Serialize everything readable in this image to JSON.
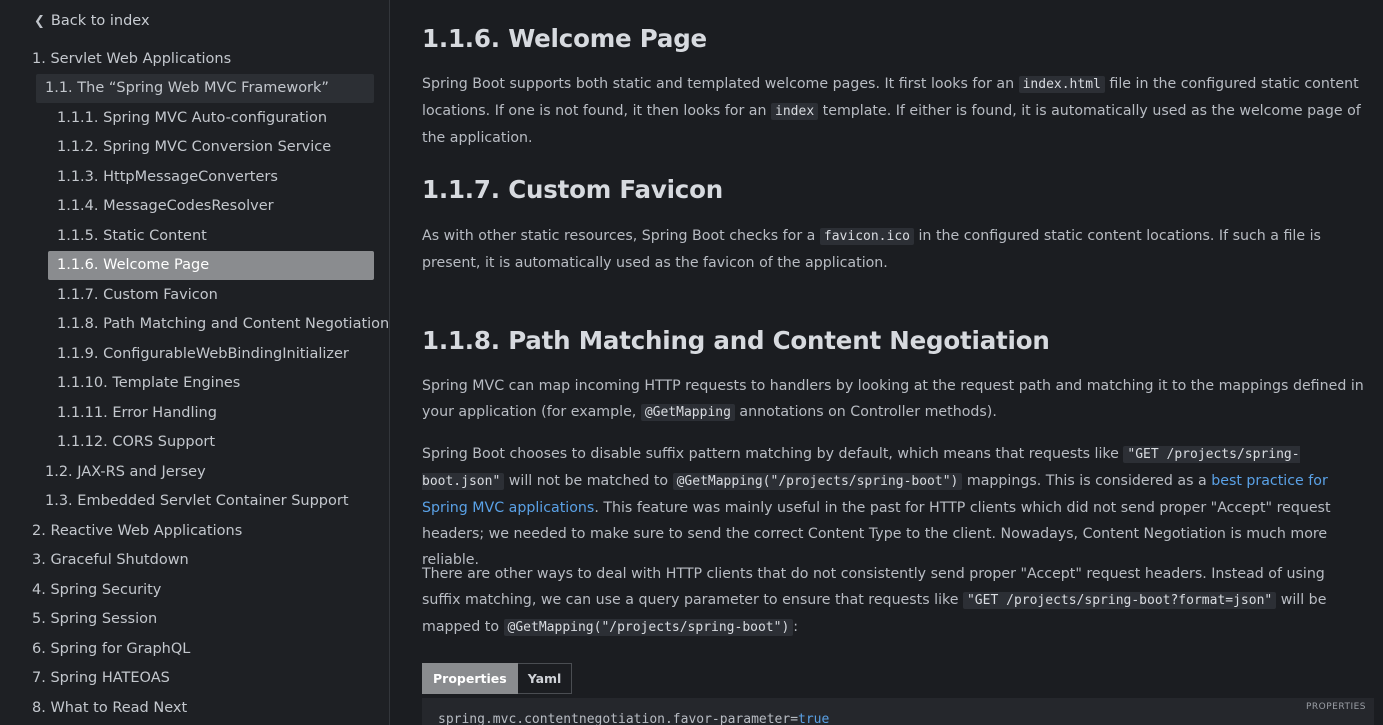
{
  "sidebar": {
    "back_label": "Back to index",
    "items": [
      {
        "label": "1. Servlet Web Applications",
        "level": 0
      },
      {
        "label": "1.1. The “Spring Web MVC Framework”",
        "level": 1
      },
      {
        "label": "1.1.1. Spring MVC Auto-configuration",
        "level": 2
      },
      {
        "label": "1.1.2. Spring MVC Conversion Service",
        "level": 2
      },
      {
        "label": "1.1.3. HttpMessageConverters",
        "level": 2
      },
      {
        "label": "1.1.4. MessageCodesResolver",
        "level": 2
      },
      {
        "label": "1.1.5. Static Content",
        "level": 2
      },
      {
        "label": "1.1.6. Welcome Page",
        "level": 2
      },
      {
        "label": "1.1.7. Custom Favicon",
        "level": 2
      },
      {
        "label": "1.1.8. Path Matching and Content Negotiation",
        "level": 2
      },
      {
        "label": "1.1.9. ConfigurableWebBindingInitializer",
        "level": 2
      },
      {
        "label": "1.1.10. Template Engines",
        "level": 2
      },
      {
        "label": "1.1.11. Error Handling",
        "level": 2
      },
      {
        "label": "1.1.12. CORS Support",
        "level": 2
      },
      {
        "label": "1.2. JAX-RS and Jersey",
        "level": 1
      },
      {
        "label": "1.3. Embedded Servlet Container Support",
        "level": 1
      },
      {
        "label": "2. Reactive Web Applications",
        "level": 0
      },
      {
        "label": "3. Graceful Shutdown",
        "level": 0
      },
      {
        "label": "4. Spring Security",
        "level": 0
      },
      {
        "label": "5. Spring Session",
        "level": 0
      },
      {
        "label": "6. Spring for GraphQL",
        "level": 0
      },
      {
        "label": "7. Spring HATEOAS",
        "level": 0
      },
      {
        "label": "8. What to Read Next",
        "level": 0
      }
    ],
    "active_label": "1.1.6. Welcome Page"
  },
  "sections": {
    "welcome": {
      "title": "1.1.6. Welcome Page",
      "p1_a": "Spring Boot supports both static and templated welcome pages. It first looks for an ",
      "p1_code1": "index.html",
      "p1_b": " file in the configured static content locations. If one is not found, it then looks for an ",
      "p1_code2": "index",
      "p1_c": " template. If either is found, it is automatically used as the welcome page of the application."
    },
    "favicon": {
      "title": "1.1.7. Custom Favicon",
      "p1_a": "As with other static resources, Spring Boot checks for a ",
      "p1_code": "favicon.ico",
      "p1_b": " in the configured static content locations. If such a file is present, it is automatically used as the favicon of the application."
    },
    "pathmatch": {
      "title": "1.1.8. Path Matching and Content Negotiation",
      "p1_a": "Spring MVC can map incoming HTTP requests to handlers by looking at the request path and matching it to the mappings defined in your application (for example, ",
      "p1_code": "@GetMapping",
      "p1_b": " annotations on Controller methods).",
      "p2_a": "Spring Boot chooses to disable suffix pattern matching by default, which means that requests like ",
      "p2_code1": "\"GET /projects/spring-boot.json\"",
      "p2_b": " will not be matched to ",
      "p2_code2": "@GetMapping(\"/projects/spring-boot\")",
      "p2_c": " mappings. This is considered as a ",
      "p2_link": "best practice for Spring MVC applications",
      "p2_d": ". This feature was mainly useful in the past for HTTP clients which did not send proper \"Accept\" request headers; we needed to make sure to send the correct Content Type to the client. Nowadays, Content Negotiation is much more reliable.",
      "p3_a": "There are other ways to deal with HTTP clients that do not consistently send proper \"Accept\" request headers. Instead of using suffix matching, we can use a query parameter to ensure that requests like ",
      "p3_code1": "\"GET /projects/spring-boot?format=json\"",
      "p3_b": " will be mapped to ",
      "p3_code2": "@GetMapping(\"/projects/spring-boot\")",
      "p3_c": ":"
    }
  },
  "code_tabs": {
    "tab1": "Properties",
    "tab2": "Yaml",
    "label": "PROPERTIES",
    "line_key": "spring.mvc.contentnegotiation.favor-parameter",
    "line_eq": "=",
    "line_val": "true"
  },
  "colors": {
    "background": "#1b1d21",
    "active_item": "#8a8c8f",
    "link": "#5aa1e6"
  }
}
